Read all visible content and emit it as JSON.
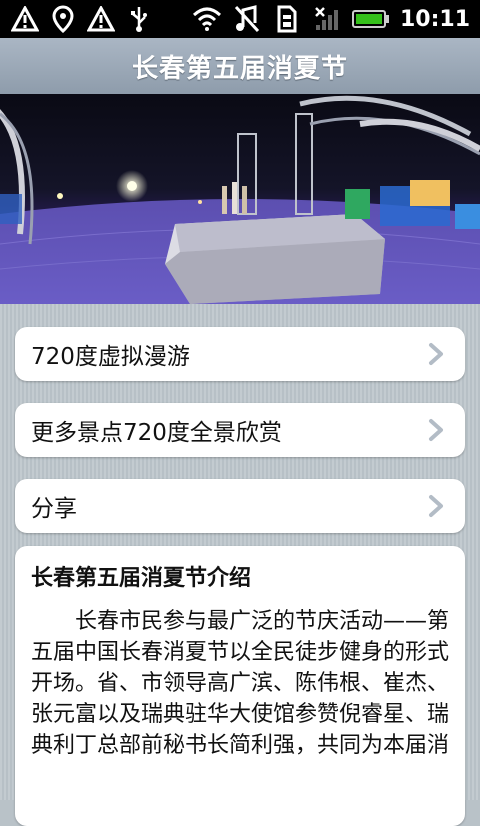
{
  "status_bar": {
    "time": "10:11",
    "icons_left": [
      "warning-icon",
      "location-pin-icon",
      "warning-icon",
      "usb-icon"
    ],
    "icons_right": [
      "wifi-icon",
      "music-off-icon",
      "sim-icon",
      "signal-icon",
      "battery-icon"
    ]
  },
  "title": "长春第五届消夏节",
  "menu": [
    {
      "label": "720度虚拟漫游"
    },
    {
      "label": "更多景点720度全景欣赏"
    },
    {
      "label": "分享"
    }
  ],
  "intro": {
    "heading": "长春第五届消夏节介绍",
    "body": "长春市民参与最广泛的节庆活动——第五届中国长春消夏节以全民徒步健身的形式开场。省、市领导高广滨、陈伟根、崔杰、张元富以及瑞典驻华大使馆参赞倪睿星、瑞典利丁总部前秘书长简利强，共同为本届消"
  },
  "colors": {
    "titlebar": "#9aa8b6",
    "battery": "#35c01a",
    "stage_light": "#4a3a9a"
  }
}
